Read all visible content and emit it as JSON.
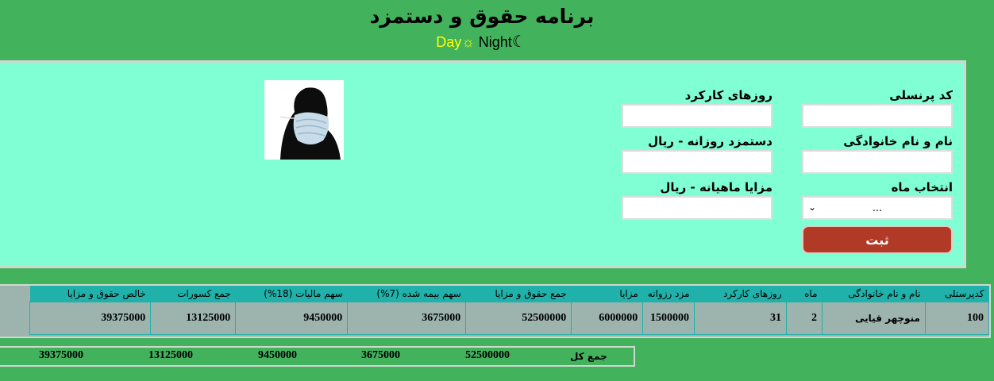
{
  "header": {
    "title": "برنامه حقوق و دستمزد",
    "day_label": "Day",
    "night_label": "Night"
  },
  "form": {
    "personnel_code_label": "کد پرنسلی",
    "work_days_label": "روزهای کارکرد",
    "full_name_label": "نام و نام خانوادگی",
    "daily_wage_label": "دستمزد روزانه - ریال",
    "month_label": "انتخاب ماه",
    "monthly_benefits_label": "مزایا ماهیانه - ریال",
    "month_selected": "...",
    "submit_label": "ثبت"
  },
  "table": {
    "headers": [
      "کدپرسنلی",
      "نام و نام خانوادگی",
      "ماه",
      "روزهای کارکرد",
      "مزد رزوانه",
      "مزایا",
      "جمع حقوق و مزایا",
      "سهم بیمه شده (7%)",
      "سهم مالیات (18%)",
      "جمع کسورات",
      "خالص حقوق و مزایا"
    ],
    "rows": [
      [
        "100",
        "منوچهر قیایی",
        "2",
        "31",
        "1500000",
        "6000000",
        "52500000",
        "3675000",
        "9450000",
        "13125000",
        "39375000"
      ]
    ]
  },
  "totals": {
    "label": "جمع کل",
    "gross": "52500000",
    "insurance": "3675000",
    "tax": "9450000",
    "deductions": "13125000",
    "net": "39375000"
  },
  "colors": {
    "background": "#43b25c",
    "panel": "#80ffd4",
    "header_row": "#20b2aa",
    "submit": "#b13a26"
  }
}
